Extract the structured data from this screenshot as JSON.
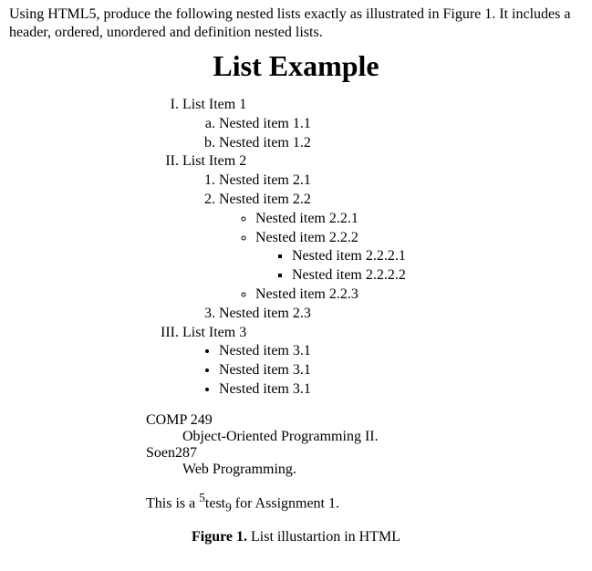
{
  "intro": "Using HTML5, produce the following nested lists exactly as illustrated in Figure 1. It includes a header, ordered, unordered and definition nested lists.",
  "title": "List Example",
  "roman": {
    "i1": "List Item 1",
    "i1_a": "Nested item 1.1",
    "i1_b": "Nested item 1.2",
    "i2": "List Item 2",
    "i2_1": "Nested item 2.1",
    "i2_2": "Nested item 2.2",
    "i2_2_1": "Nested item 2.2.1",
    "i2_2_2": "Nested item 2.2.2",
    "i2_2_2_1": "Nested item 2.2.2.1",
    "i2_2_2_2": "Nested item 2.2.2.2",
    "i2_2_3": "Nested item 2.2.3",
    "i2_3": "Nested item 2.3",
    "i3": "List Item 3",
    "i3_a": "Nested item 3.1",
    "i3_b": "Nested item 3.1",
    "i3_c": "Nested item 3.1"
  },
  "defs": {
    "t1": "COMP 249",
    "d1": "Object-Oriented Programming II.",
    "t2": "Soen287",
    "d2": "Web Programming."
  },
  "note": {
    "pre": "This is a ",
    "sup": "5",
    "mid": "test",
    "sub": "9",
    "post": " for Assignment 1."
  },
  "caption": {
    "label": "Figure 1.",
    "text": " List illustartion in HTML"
  }
}
